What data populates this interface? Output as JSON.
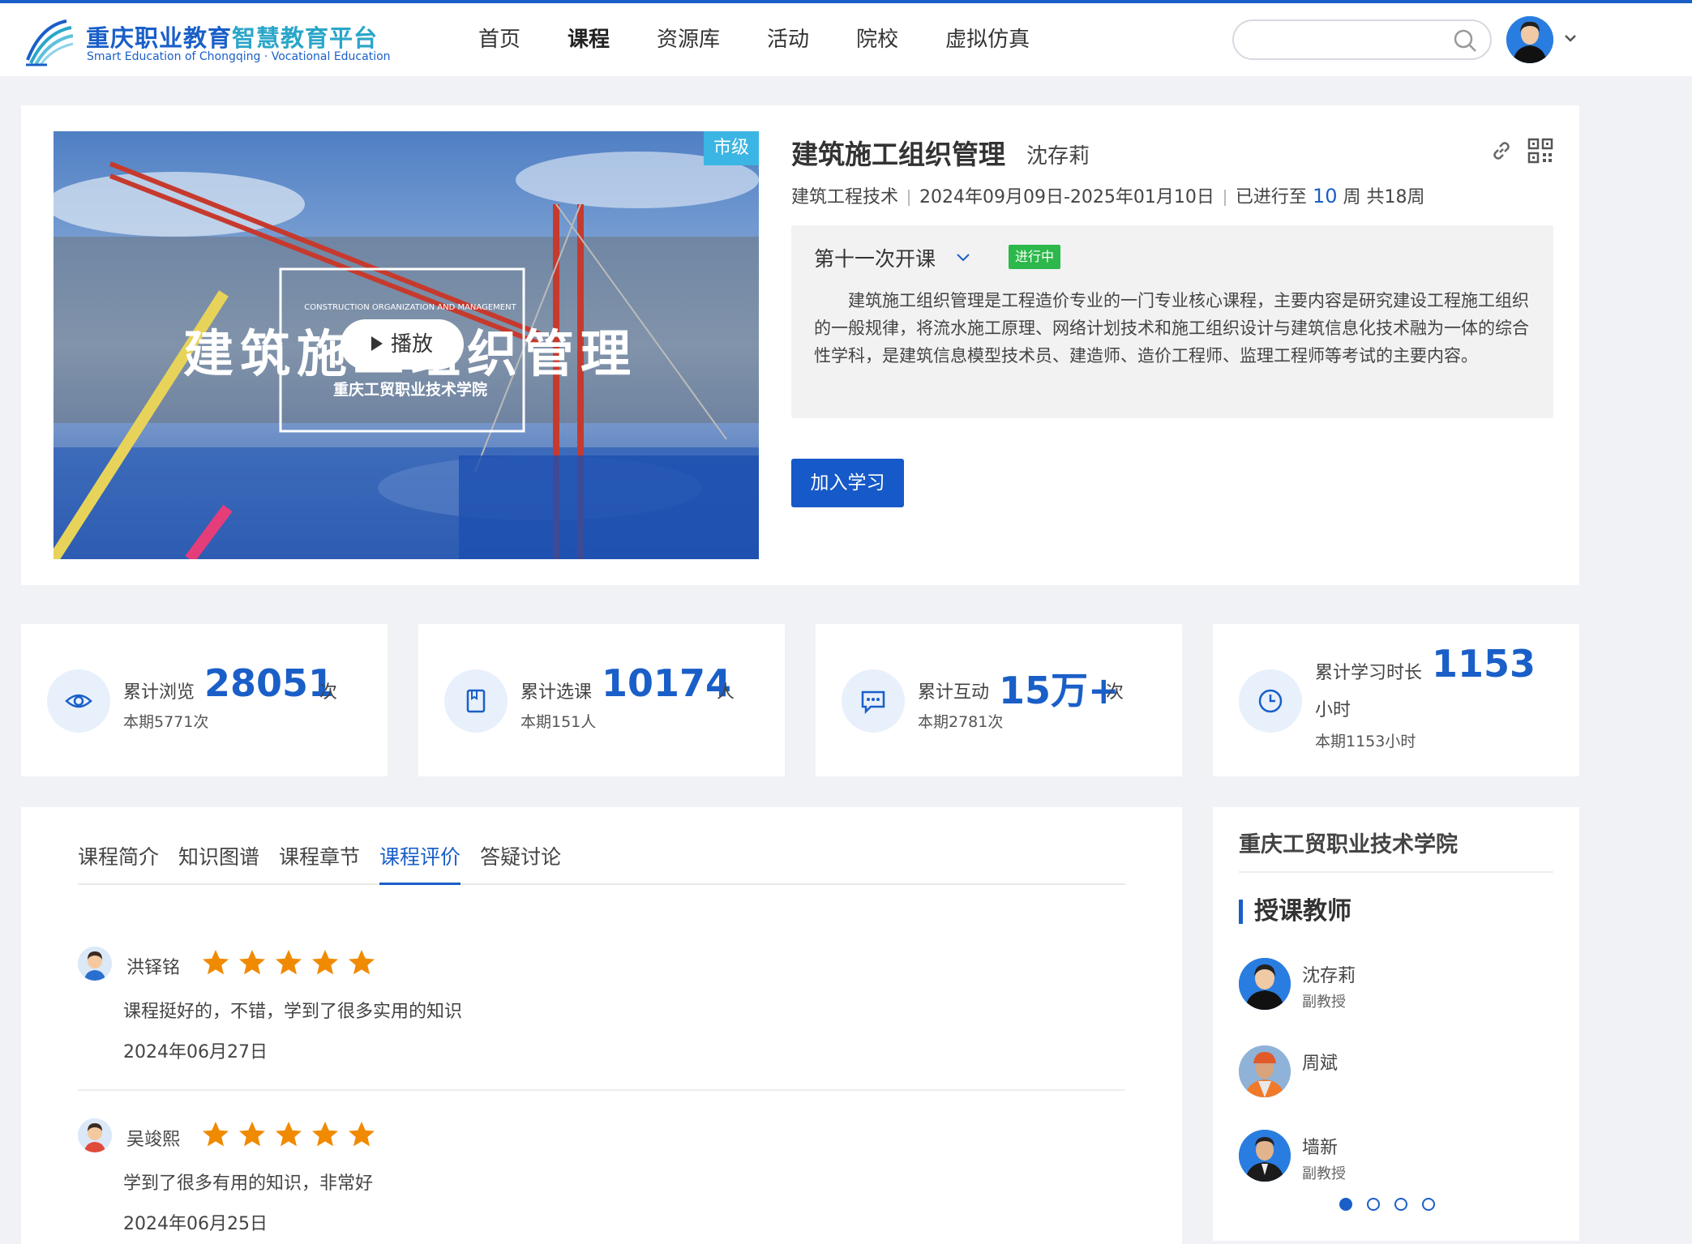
{
  "brand": {
    "name_cn_part1": "重庆职业教育",
    "name_cn_part2": "智慧教育平台",
    "name_en": "Smart Education of Chongqing · Vocational Education"
  },
  "nav": [
    {
      "label": "首页",
      "active": false
    },
    {
      "label": "课程",
      "active": true
    },
    {
      "label": "资源库",
      "active": false
    },
    {
      "label": "活动",
      "active": false
    },
    {
      "label": "院校",
      "active": false
    },
    {
      "label": "虚拟仿真",
      "active": false
    }
  ],
  "search": {
    "placeholder": "",
    "value": ""
  },
  "course": {
    "level_badge": "市级",
    "cover_title": "建筑施工组织管理",
    "cover_subtitle_en": "CONSTRUCTION ORGANIZATION AND MANAGEMENT",
    "cover_school": "重庆工贸职业技术学院",
    "play_label": "播放",
    "title": "建筑施工组织管理",
    "teacher": "沈存莉",
    "major": "建筑工程技术",
    "date_range": "2024年09月09日-2025年01月10日",
    "progress_prefix": "已进行至",
    "progress_week": "10",
    "progress_suffix": "周 共18周",
    "session": "第十一次开课",
    "status": "进行中",
    "description": "建筑施工组织管理是工程造价专业的一门专业核心课程，主要内容是研究建设工程施工组织的一般规律，将流水施工原理、网络计划技术和施工组织设计与建筑信息化技术融为一体的综合性学科，是建筑信息模型技术员、建造师、造价工程师、监理工程师等考试的主要内容。",
    "join_label": "加入学习"
  },
  "stats": [
    {
      "icon": "eye-icon",
      "label": "累计浏览",
      "value": "28051",
      "unit": "次",
      "sub": "本期5771次"
    },
    {
      "icon": "book-icon",
      "label": "累计选课",
      "value": "10174",
      "unit": "人",
      "sub": "本期151人"
    },
    {
      "icon": "chat-icon",
      "label": "累计互动",
      "value": "15万+",
      "unit": "次",
      "sub": "本期2781次"
    },
    {
      "icon": "clock-icon",
      "label": "累计学习时长",
      "value": "1153",
      "unit": "小时",
      "sub": "本期1153小时"
    }
  ],
  "tabs": [
    {
      "label": "课程简介",
      "active": false
    },
    {
      "label": "知识图谱",
      "active": false
    },
    {
      "label": "课程章节",
      "active": false
    },
    {
      "label": "课程评价",
      "active": true
    },
    {
      "label": "答疑讨论",
      "active": false
    }
  ],
  "reviews": [
    {
      "name": "洪铎铭",
      "rating": 5,
      "text": "课程挺好的，不错，学到了很多实用的知识",
      "date": "2024年06月27日"
    },
    {
      "name": "吴竣熙",
      "rating": 5,
      "text": "学到了很多有用的知识，非常好",
      "date": "2024年06月25日"
    }
  ],
  "sidebar": {
    "school": "重庆工贸职业技术学院",
    "section_title": "授课教师",
    "teachers": [
      {
        "name": "沈存莉",
        "title": "副教授"
      },
      {
        "name": "周斌",
        "title": ""
      },
      {
        "name": "墙新",
        "title": "副教授"
      }
    ],
    "page_count": 4,
    "active_page": 1
  },
  "colors": {
    "primary": "#1a5fc8",
    "badge": "#3bb5e3",
    "status_green": "#2cb84a",
    "star": "#f08a00"
  }
}
